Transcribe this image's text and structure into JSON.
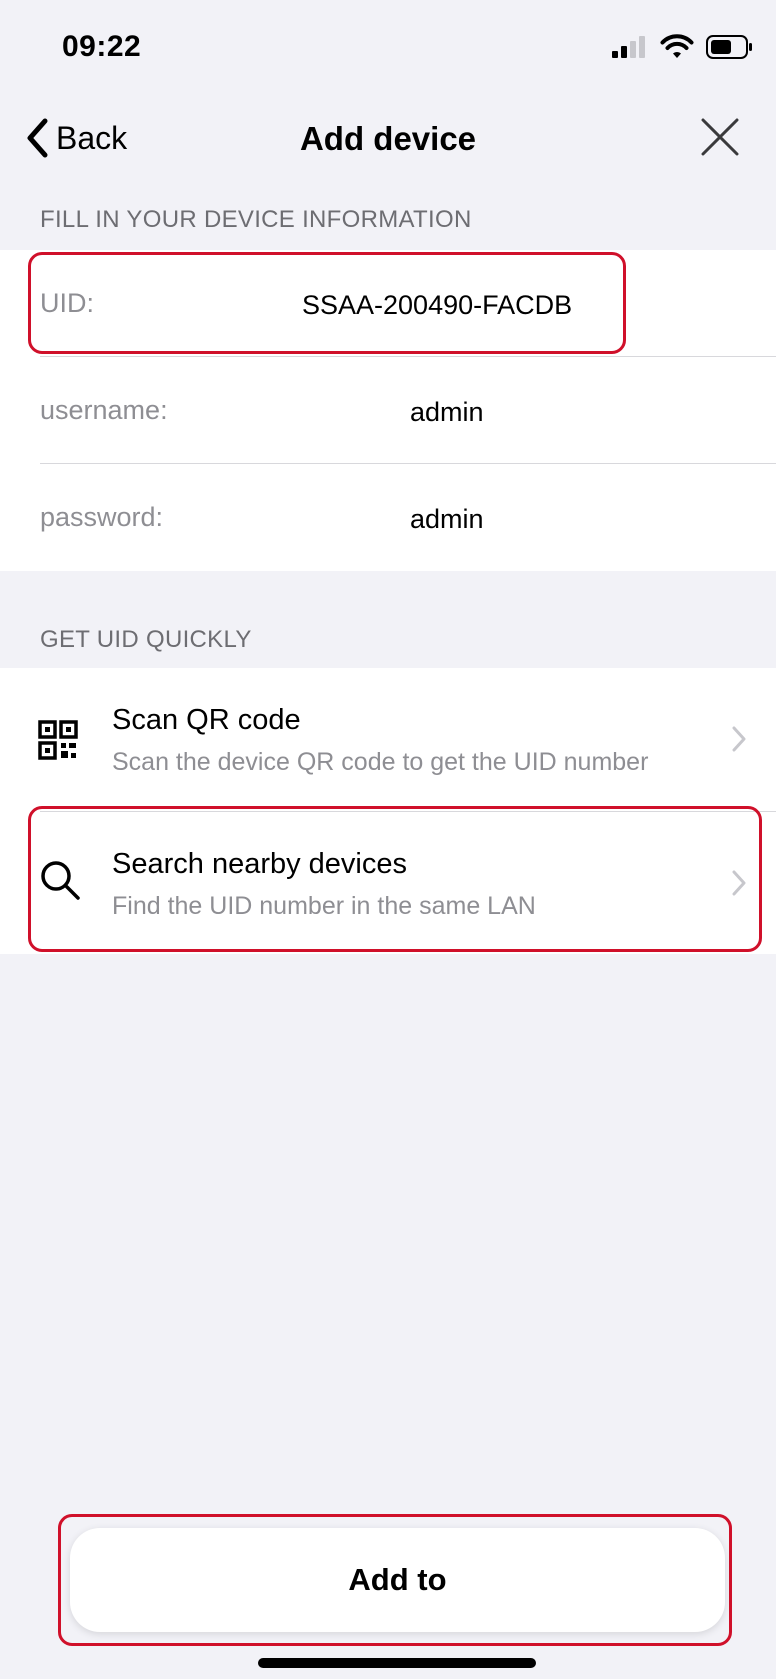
{
  "status_bar": {
    "time": "09:22"
  },
  "nav": {
    "back_label": "Back",
    "title": "Add device"
  },
  "device_info": {
    "header": "FILL IN YOUR DEVICE INFORMATION",
    "fields": [
      {
        "label": "UID:",
        "value": "SSAA-200490-FACDB"
      },
      {
        "label": "username:",
        "value": "admin"
      },
      {
        "label": "password:",
        "value": "admin"
      }
    ]
  },
  "quick_uid": {
    "header": "GET UID QUICKLY",
    "items": [
      {
        "title": "Scan QR code",
        "subtitle": "Scan the device QR code to get the UID number",
        "icon": "qr-code-icon"
      },
      {
        "title": "Search nearby devices",
        "subtitle": "Find the UID number in the same LAN",
        "icon": "search-icon"
      }
    ]
  },
  "footer": {
    "add_label": "Add to"
  },
  "colors": {
    "highlight": "#d0102a",
    "background": "#f2f2f7",
    "secondary_text": "#8e8e93"
  }
}
